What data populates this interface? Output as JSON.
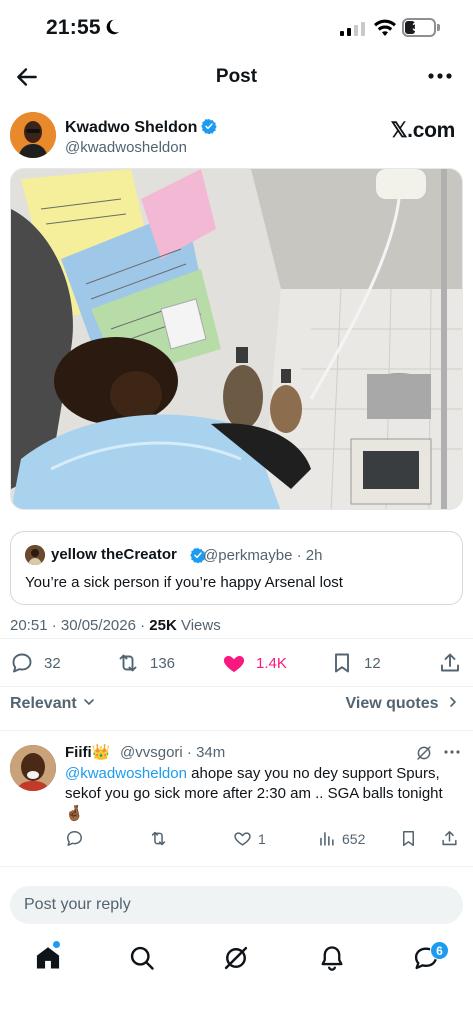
{
  "status": {
    "time": "21:55",
    "battery": "35",
    "battery_level": 0.35
  },
  "header": {
    "title": "Post"
  },
  "post": {
    "author_name": "Kwadwo Sheldon",
    "author_handle": "@kwadwosheldon",
    "watermark": "𝕏.com",
    "timestamp": "20:51 · 30/05/2026 ·",
    "views_count": "25K",
    "views_label": "Views",
    "replies": "32",
    "reposts": "136",
    "likes": "1.4K",
    "bookmarks": "12"
  },
  "quote": {
    "name": "yellow theCreator",
    "meta": "@perkmaybe · 2h",
    "text": "You’re a sick person if you’re happy Arsenal lost"
  },
  "sort": {
    "relevant": "Relevant",
    "view_quotes": "View quotes"
  },
  "reply": {
    "name": "Fiifi👑",
    "meta": "@vvsgori · 34m",
    "mention": "@kwadwosheldon",
    "text": " ahope say you no dey support Spurs, sekof you go sick more after 2:30 am .. SGA balls tonight 🤞🏾",
    "replies": "",
    "likes": "1",
    "views": "652"
  },
  "composer": {
    "placeholder": "Post your reply"
  },
  "tabbar": {
    "notifications_badge": "6"
  },
  "colors": {
    "accent": "#1d9bf0",
    "like": "#f91880",
    "muted": "#536471"
  }
}
